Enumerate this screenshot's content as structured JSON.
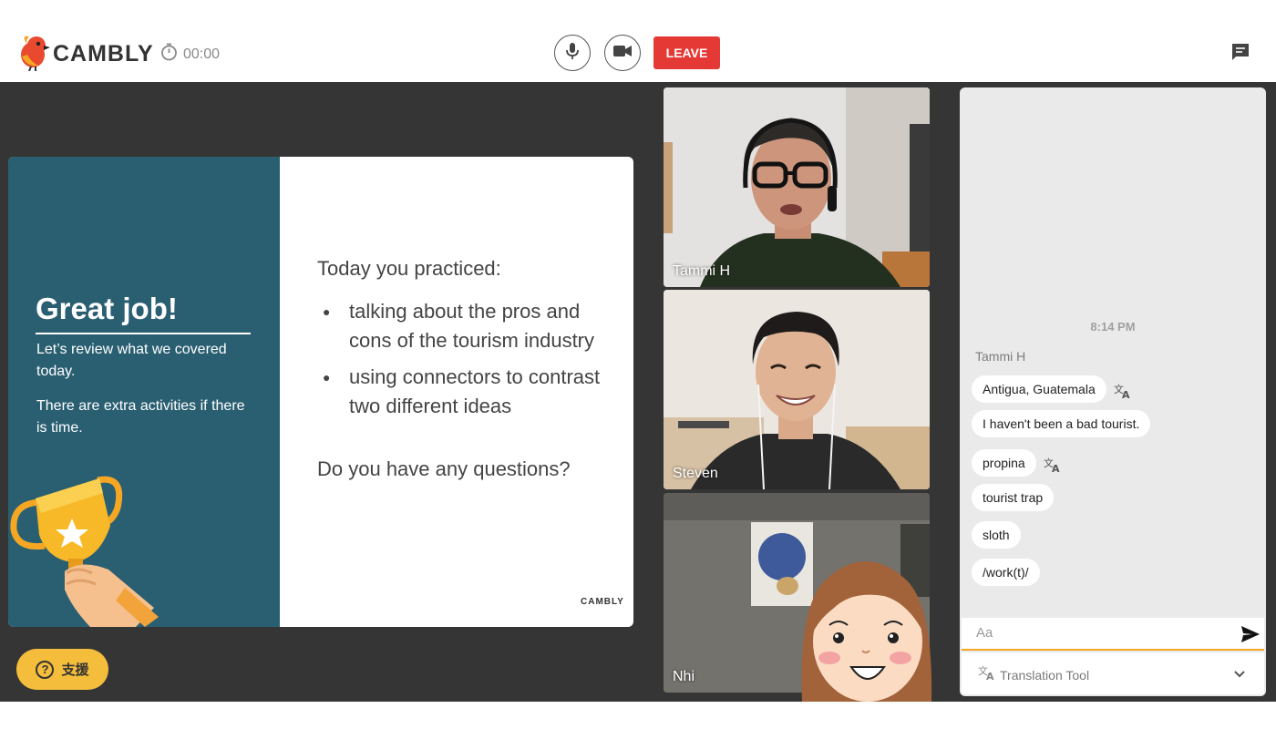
{
  "header": {
    "brand": "CAMBLY",
    "timer": "00:00",
    "leave_label": "LEAVE"
  },
  "slide": {
    "title": "Great job!",
    "subtitle_1": "Let’s review what we covered today.",
    "subtitle_2": "There are extra activities if there is time.",
    "heading": "Today you practiced:",
    "points": [
      "talking about the pros and cons of the tourism industry",
      "using connectors to contrast two different ideas"
    ],
    "question": "Do you have any questions?",
    "brand": "CAMBLY"
  },
  "participants": [
    {
      "name": "Tammi H"
    },
    {
      "name": "Steven"
    },
    {
      "name": "Nhi"
    }
  ],
  "chat": {
    "timestamp": "8:14 PM",
    "sender": "Tammi H",
    "messages": [
      {
        "text": "Antigua, Guatemala",
        "translatable": true
      },
      {
        "text": "I haven't been a bad tourist.",
        "translatable": false
      },
      {
        "text": "propina",
        "translatable": true
      },
      {
        "text": "tourist trap",
        "translatable": false
      },
      {
        "text": "sloth",
        "translatable": false
      },
      {
        "text": "/work(t)/",
        "translatable": false
      }
    ],
    "input_placeholder": "Aa",
    "translation_tool_label": "Translation Tool"
  },
  "support": {
    "label": "支援"
  },
  "colors": {
    "leave": "#e53935",
    "slide_panel": "#2a5f72",
    "support": "#f4bd3b",
    "stage": "#353535",
    "input_accent": "#f5a623"
  },
  "icons": [
    "logo-bird-icon",
    "stopwatch-icon",
    "microphone-icon",
    "camera-icon",
    "chat-icon",
    "translate-icon",
    "send-icon",
    "chevron-down-icon",
    "help-icon",
    "trophy-icon"
  ]
}
